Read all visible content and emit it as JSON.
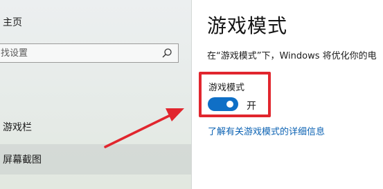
{
  "sidebar": {
    "home_label": "主页",
    "search_placeholder": "找设置",
    "items": [
      {
        "label": "游戏栏"
      },
      {
        "label": "屏幕截图"
      }
    ]
  },
  "main": {
    "title": "游戏模式",
    "description": "在“游戏模式”下，Windows 将优化你的电",
    "game_mode": {
      "label": "游戏模式",
      "state": "开",
      "on": true
    },
    "link_text": "了解有关游戏模式的详细信息"
  },
  "colors": {
    "accent": "#0f6fc6",
    "highlight": "#e1262e",
    "link": "#0b62b3"
  },
  "icons": [
    "search-icon",
    "red-arrow-annotation"
  ]
}
